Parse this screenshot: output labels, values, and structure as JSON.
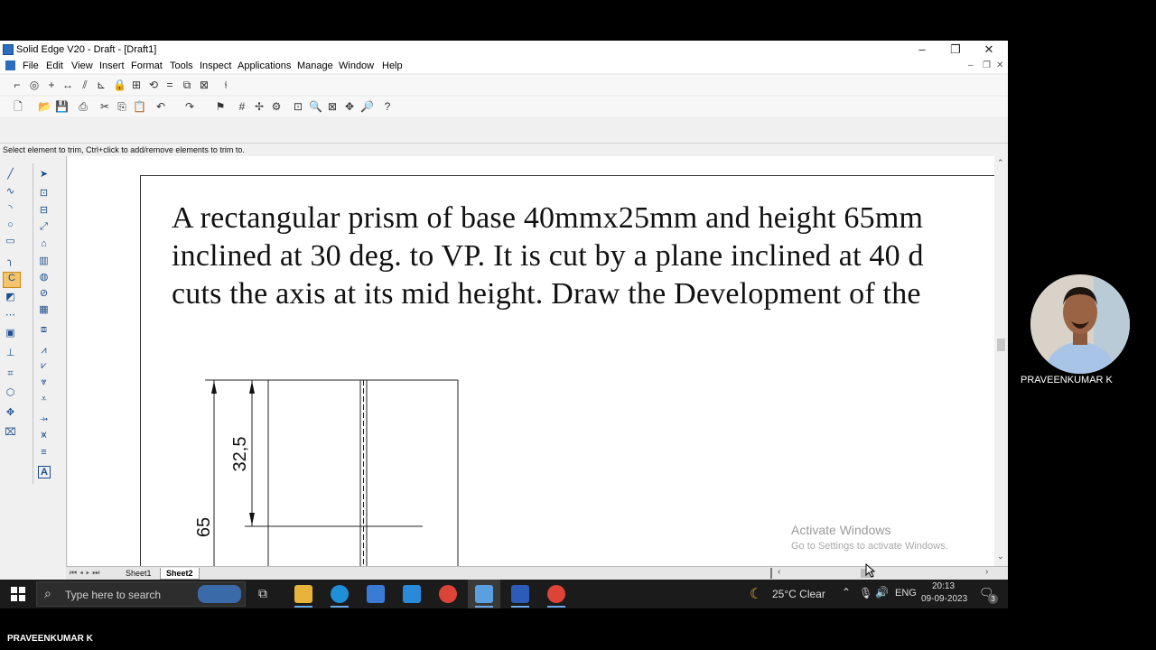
{
  "window": {
    "title": "Solid Edge V20 - Draft - [Draft1]",
    "minimize": "–",
    "restore": "❐",
    "close": "✕"
  },
  "menu": [
    "File",
    "Edit",
    "View",
    "Insert",
    "Format",
    "Tools",
    "Inspect",
    "Applications",
    "Manage",
    "Window",
    "Help"
  ],
  "mdi_controls": [
    "–",
    "❐",
    "✕"
  ],
  "prompt": "Select element to trim, Ctrl+click to add/remove elements to trim to.",
  "question": {
    "line1": "A rectangular prism of base 40mmx25mm and height 65mm",
    "line2": "inclined at 30 deg. to VP. It is cut by a plane inclined at 40 d",
    "line3": "cuts the axis at its mid height. Draw the Development of the"
  },
  "dimensions": {
    "height": "65",
    "half_height": "32,5"
  },
  "sheets": {
    "sheet1": "Sheet1",
    "sheet2": "Sheet2",
    "active": "Sheet2"
  },
  "watermark": {
    "line1": "Activate Windows",
    "line2": "Go to Settings to activate Windows."
  },
  "taskbar": {
    "search_placeholder": "Type here to search",
    "weather": "25°C  Clear",
    "language": "ENG",
    "time": "20:13",
    "date": "09-09-2023",
    "notification_count": "3"
  },
  "presenter": {
    "name": "PRAVEENKUMAR K",
    "footer_name": "PRAVEENKUMAR K"
  },
  "colors": {
    "taskbar": "#1b1b1b",
    "accent": "#2a6ebd",
    "background": "#000000"
  }
}
